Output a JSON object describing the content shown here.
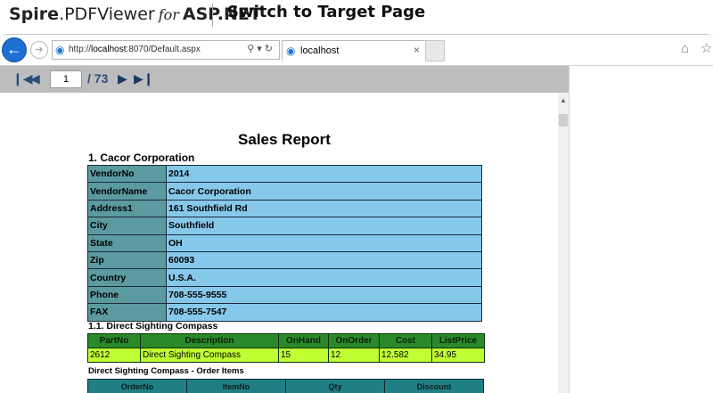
{
  "caption": {
    "brand_bold": "Spire",
    "brand_product": ".PDFViewer",
    "brand_for": "for",
    "brand_platform": "ASP.NET",
    "switch_label": "Switch to Target Page"
  },
  "browser": {
    "url_prefix": "http://",
    "url_host": "localhost",
    "url_rest": ":8070/Default.aspx",
    "tab_label": "localhost",
    "back_icon": "back-arrow-icon",
    "forward_icon": "forward-arrow-icon",
    "home_icon": "home-icon",
    "favorites_icon": "star-icon"
  },
  "viewer_toolbar": {
    "page_value": "1",
    "page_total": "/ 73"
  },
  "report": {
    "title": "Sales Report",
    "section1": "1. Cacor Corporation",
    "vendor_rows": [
      {
        "k": "VendorNo",
        "v": "2014"
      },
      {
        "k": "VendorName",
        "v": "Cacor Corporation"
      },
      {
        "k": "Address1",
        "v": "161 Southfield Rd"
      },
      {
        "k": "City",
        "v": "Southfield"
      },
      {
        "k": "State",
        "v": "OH"
      },
      {
        "k": "Zip",
        "v": "60093"
      },
      {
        "k": "Country",
        "v": "U.S.A."
      },
      {
        "k": "Phone",
        "v": "708-555-9555"
      },
      {
        "k": "FAX",
        "v": "708-555-7547"
      }
    ],
    "section2": "1.1. Direct Sighting Compass",
    "parts_headers": [
      "PartNo",
      "Description",
      "OnHand",
      "OnOrder",
      "Cost",
      "ListPrice"
    ],
    "parts_row": [
      "2612",
      "Direct Sighting Compass",
      "15",
      "12",
      "12.582",
      "34.95"
    ],
    "section3": "Direct Sighting Compass - Order Items",
    "order_headers": [
      "OrderNo",
      "ItemNo",
      "Qty",
      "Discount"
    ]
  },
  "colors": {
    "vendor_key_bg": "#5b9a9f",
    "vendor_val_bg": "#86c8ea",
    "parts_header_bg": "#2a8a2a",
    "parts_row_bg": "#bfff33",
    "orders_header_bg": "#1f7f85",
    "toolbar_bg": "#bdbdbd",
    "back_button": "#1e6fd1"
  }
}
